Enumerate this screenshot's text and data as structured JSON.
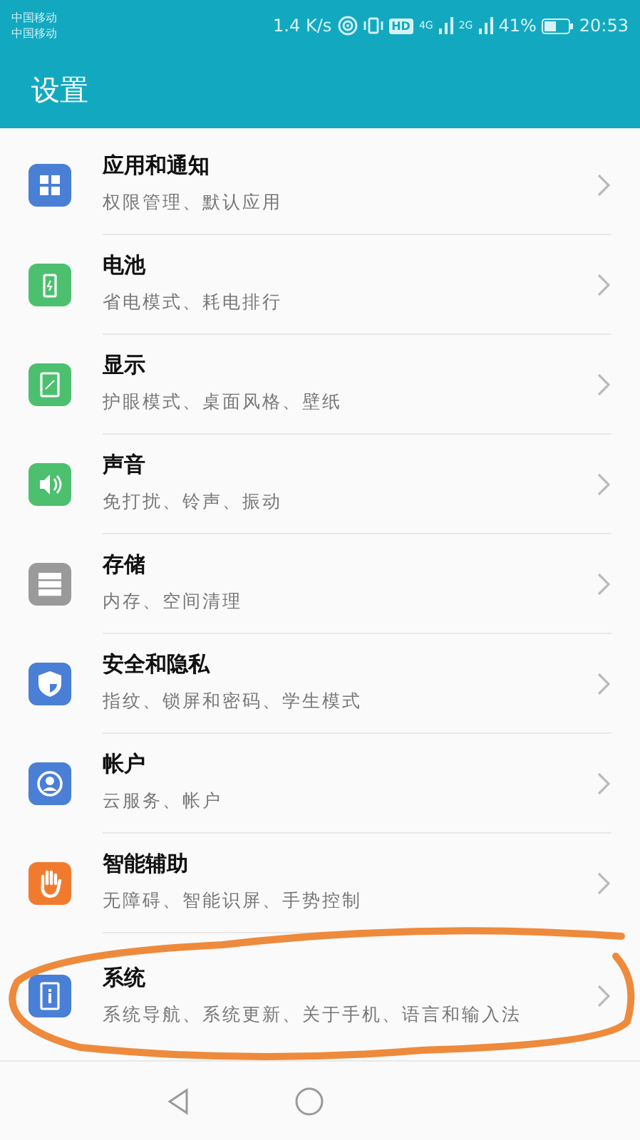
{
  "status_bar": {
    "carriers": [
      "中国移动",
      "中国移动"
    ],
    "speed": "1.4 K/s",
    "hd": "HD",
    "network_1": "4G",
    "network_2": "2G",
    "battery": "41%",
    "time": "20:53"
  },
  "header": {
    "title": "设置"
  },
  "items": [
    {
      "title": "应用和通知",
      "subtitle": "权限管理、默认应用",
      "color": "#4a7fd6"
    },
    {
      "title": "电池",
      "subtitle": "省电模式、耗电排行",
      "color": "#4cc06f"
    },
    {
      "title": "显示",
      "subtitle": "护眼模式、桌面风格、壁纸",
      "color": "#4cc06f"
    },
    {
      "title": "声音",
      "subtitle": "免打扰、铃声、振动",
      "color": "#4cc06f"
    },
    {
      "title": "存储",
      "subtitle": "内存、空间清理",
      "color": "#9a9a9a"
    },
    {
      "title": "安全和隐私",
      "subtitle": "指纹、锁屏和密码、学生模式",
      "color": "#4a7fd6"
    },
    {
      "title": "帐户",
      "subtitle": "云服务、帐户",
      "color": "#4a7fd6"
    },
    {
      "title": "智能辅助",
      "subtitle": "无障碍、智能识屏、手势控制",
      "color": "#f07b2e"
    },
    {
      "title": "系统",
      "subtitle": "系统导航、系统更新、关于手机、语言和输入法",
      "color": "#4a7fd6",
      "annotated": true
    }
  ]
}
